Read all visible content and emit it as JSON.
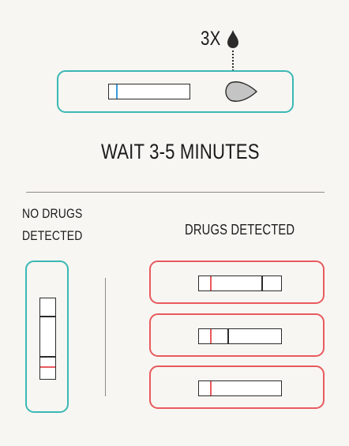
{
  "instructions": {
    "drop_count": "3X",
    "wait_text": "WAIT 3-5 MINUTES"
  },
  "results": {
    "negative_label_line1": "NO DRUGS",
    "negative_label_line2": "DETECTED",
    "positive_label": "DRUGS DETECTED"
  },
  "colors": {
    "teal": "#3ab8b5",
    "red": "#e85a5e",
    "blue": "#3a9ad9",
    "ink": "#2b2b2b",
    "background": "#f8f6f2"
  },
  "icons": [
    "water-drop-icon",
    "sample-well-icon"
  ]
}
